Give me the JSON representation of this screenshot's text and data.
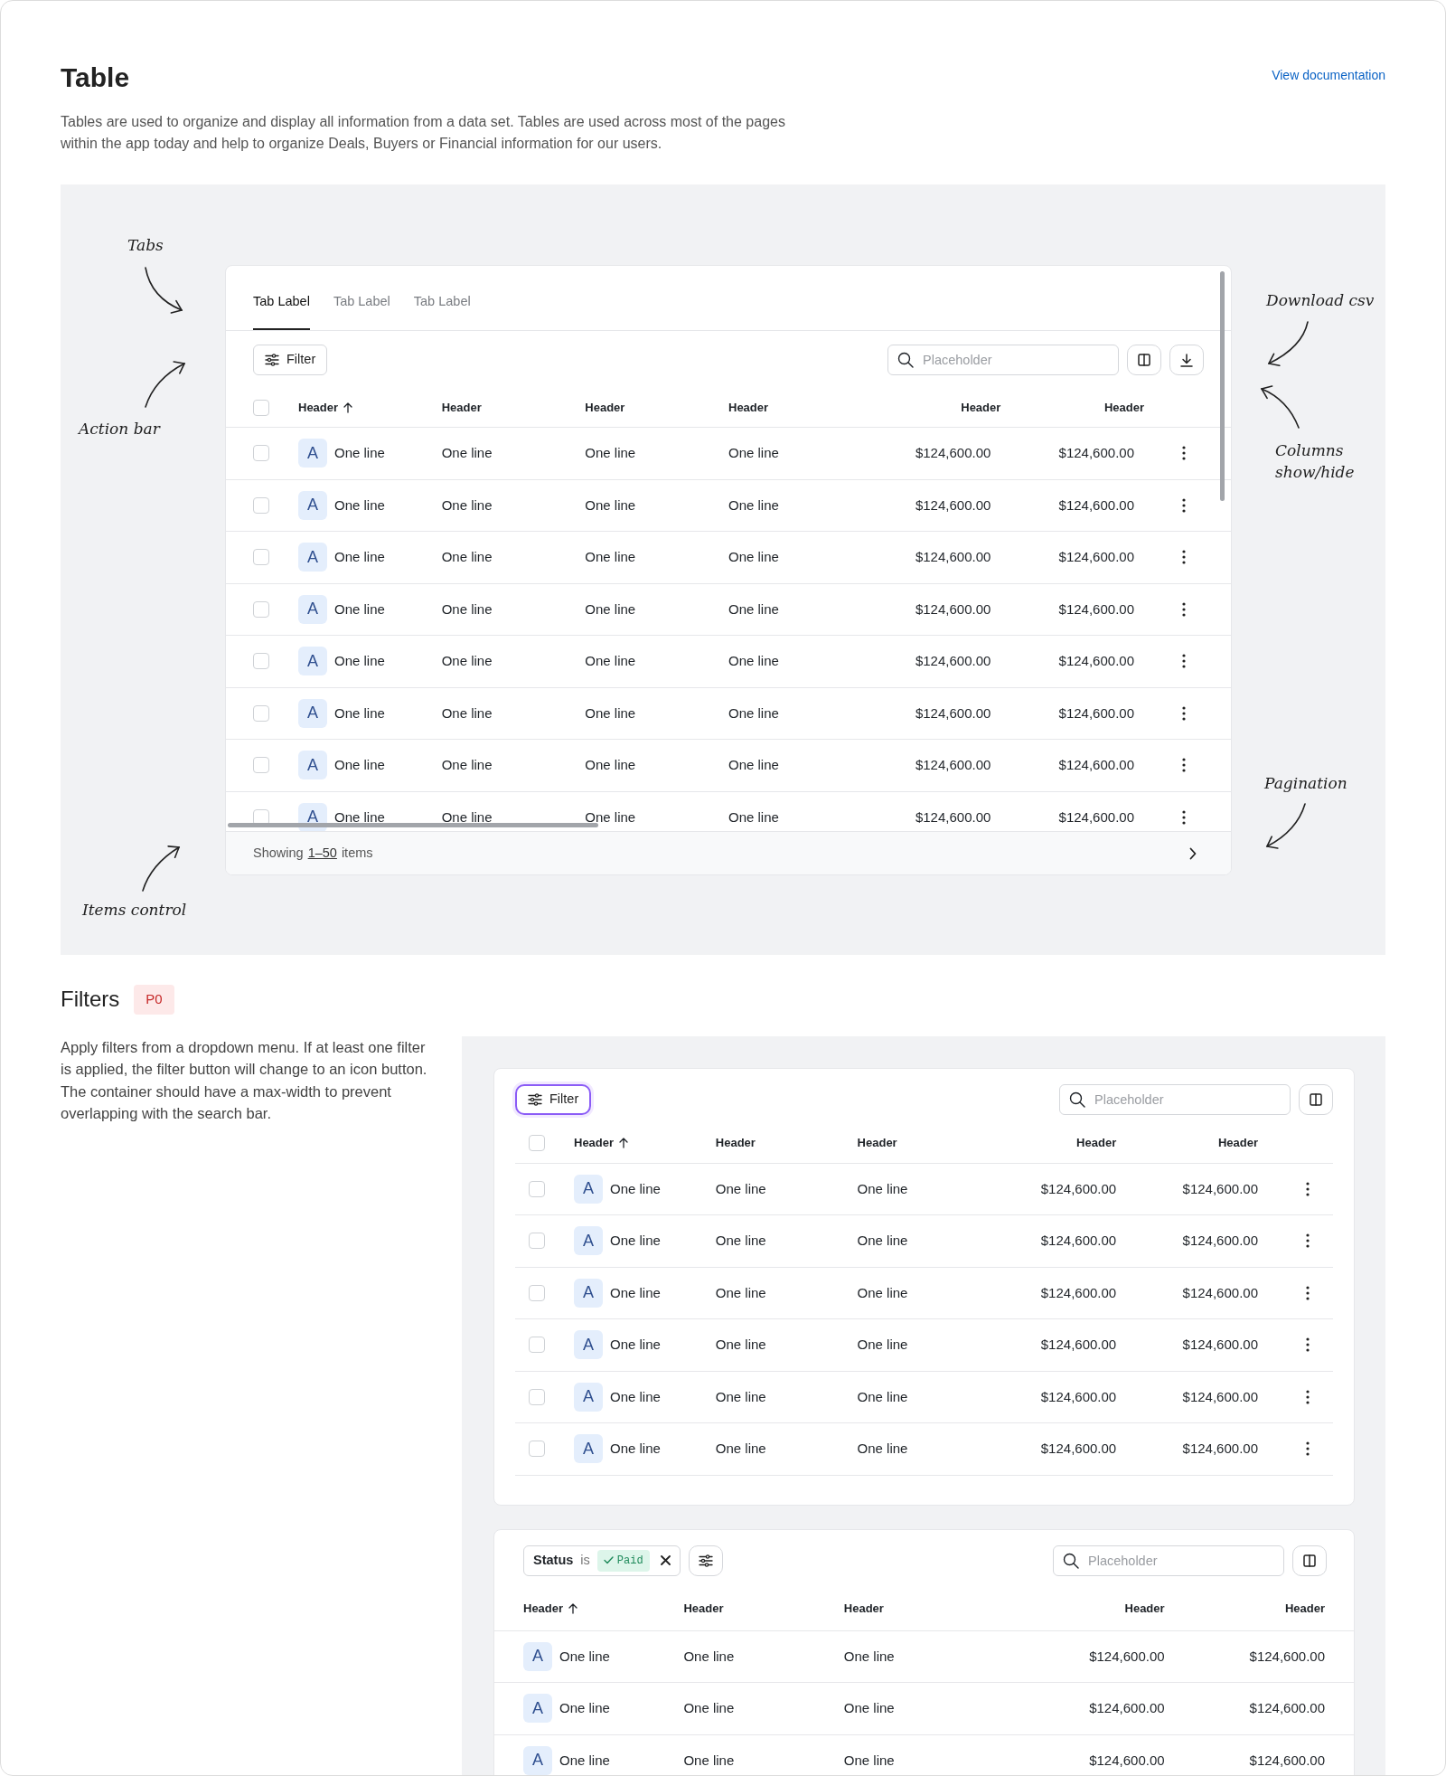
{
  "header": {
    "title": "Table",
    "description": "Tables are used to organize and display all information from a data set. Tables are used across most of the pages within the app today and help to organize Deals, Buyers or Financial information for our users.",
    "link": "View documentation"
  },
  "overview": {
    "annotations": [
      "Tabs",
      "Action bar",
      "Items control",
      "Download csv",
      "Columns show/hide",
      "Pagination"
    ],
    "table": {
      "tabs": [
        {
          "label": "Tab Label",
          "selected": true
        },
        {
          "label": "Tab Label",
          "selected": false
        },
        {
          "label": "Tab Label",
          "selected": false
        }
      ],
      "filter": {
        "label": "Filter",
        "active": false
      },
      "search": {
        "placeholder": "Placeholder"
      },
      "actions": [
        {
          "kind": "columns"
        },
        {
          "kind": "download"
        }
      ],
      "selectable": true,
      "all_checked": false,
      "row_actions": true,
      "columns": [
        {
          "label": "Header",
          "kind": "name",
          "sorted": true
        },
        {
          "label": "Header",
          "kind": "text",
          "sorted": false
        },
        {
          "label": "Header",
          "kind": "text",
          "sorted": false
        },
        {
          "label": "Header",
          "kind": "text",
          "sorted": false
        },
        {
          "label": "Header",
          "kind": "amount",
          "sorted": false
        },
        {
          "label": "Header",
          "kind": "amount",
          "sorted": false
        }
      ],
      "rows": [
        {
          "checked": false,
          "avatar": "A",
          "cells": [
            "One line",
            "One line",
            "One line",
            "One line",
            "$124,600.00",
            "$124,600.00"
          ]
        },
        {
          "checked": false,
          "avatar": "A",
          "cells": [
            "One line",
            "One line",
            "One line",
            "One line",
            "$124,600.00",
            "$124,600.00"
          ]
        },
        {
          "checked": false,
          "avatar": "A",
          "cells": [
            "One line",
            "One line",
            "One line",
            "One line",
            "$124,600.00",
            "$124,600.00"
          ]
        },
        {
          "checked": false,
          "avatar": "A",
          "cells": [
            "One line",
            "One line",
            "One line",
            "One line",
            "$124,600.00",
            "$124,600.00"
          ]
        },
        {
          "checked": false,
          "avatar": "A",
          "cells": [
            "One line",
            "One line",
            "One line",
            "One line",
            "$124,600.00",
            "$124,600.00"
          ]
        },
        {
          "checked": false,
          "avatar": "A",
          "cells": [
            "One line",
            "One line",
            "One line",
            "One line",
            "$124,600.00",
            "$124,600.00"
          ]
        },
        {
          "checked": false,
          "avatar": "A",
          "cells": [
            "One line",
            "One line",
            "One line",
            "One line",
            "$124,600.00",
            "$124,600.00"
          ]
        },
        {
          "checked": false,
          "avatar": "A",
          "cells": [
            "One line",
            "One line",
            "One line",
            "One line",
            "$124,600.00",
            "$124,600.00"
          ]
        }
      ],
      "footer": {
        "prefix": "Showing",
        "range": "1–50",
        "suffix": "items"
      }
    }
  },
  "filters": {
    "title": "Filters",
    "badge": "P0",
    "description": "Apply filters from a dropdown menu. If at least one filter is applied, the filter button will change to an icon button. The container should have a max-width to prevent overlapping with the search bar.",
    "examples": [
      {
        "filter": {
          "label": "Filter",
          "active": true
        },
        "search": {
          "placeholder": "Placeholder"
        },
        "actions": [
          {
            "kind": "columns"
          }
        ],
        "selectable": true,
        "all_checked": false,
        "row_actions": true,
        "columns": [
          {
            "label": "Header",
            "kind": "name",
            "sorted": true
          },
          {
            "label": "Header",
            "kind": "text",
            "sorted": false
          },
          {
            "label": "Header",
            "kind": "text",
            "sorted": false
          },
          {
            "label": "Header",
            "kind": "amount",
            "sorted": false
          },
          {
            "label": "Header",
            "kind": "amount",
            "sorted": false
          }
        ],
        "rows": [
          {
            "checked": false,
            "avatar": "A",
            "cells": [
              "One line",
              "One line",
              "One line",
              "$124,600.00",
              "$124,600.00"
            ]
          },
          {
            "checked": false,
            "avatar": "A",
            "cells": [
              "One line",
              "One line",
              "One line",
              "$124,600.00",
              "$124,600.00"
            ]
          },
          {
            "checked": false,
            "avatar": "A",
            "cells": [
              "One line",
              "One line",
              "One line",
              "$124,600.00",
              "$124,600.00"
            ]
          },
          {
            "checked": false,
            "avatar": "A",
            "cells": [
              "One line",
              "One line",
              "One line",
              "$124,600.00",
              "$124,600.00"
            ]
          },
          {
            "checked": false,
            "avatar": "A",
            "cells": [
              "One line",
              "One line",
              "One line",
              "$124,600.00",
              "$124,600.00"
            ]
          },
          {
            "checked": false,
            "avatar": "A",
            "cells": [
              "One line",
              "One line",
              "One line",
              "$124,600.00",
              "$124,600.00"
            ]
          }
        ]
      },
      {
        "filter_chip": {
          "field": "Status",
          "operator": "is",
          "value": "Paid"
        },
        "search": {
          "placeholder": "Placeholder"
        },
        "actions": [
          {
            "kind": "columns"
          }
        ],
        "selectable": false,
        "row_actions": false,
        "columns": [
          {
            "label": "Header",
            "kind": "name",
            "sorted": true
          },
          {
            "label": "Header",
            "kind": "text",
            "sorted": false
          },
          {
            "label": "Header",
            "kind": "text",
            "sorted": false
          },
          {
            "label": "Header",
            "kind": "amount",
            "sorted": false
          },
          {
            "label": "Header",
            "kind": "amount",
            "sorted": false
          }
        ],
        "rows": [
          {
            "avatar": "A",
            "cells": [
              "One line",
              "One line",
              "One line",
              "$124,600.00",
              "$124,600.00"
            ]
          },
          {
            "avatar": "A",
            "cells": [
              "One line",
              "One line",
              "One line",
              "$124,600.00",
              "$124,600.00"
            ]
          },
          {
            "avatar": "A",
            "cells": [
              "One line",
              "One line",
              "One line",
              "$124,600.00",
              "$124,600.00"
            ]
          }
        ]
      }
    ]
  }
}
